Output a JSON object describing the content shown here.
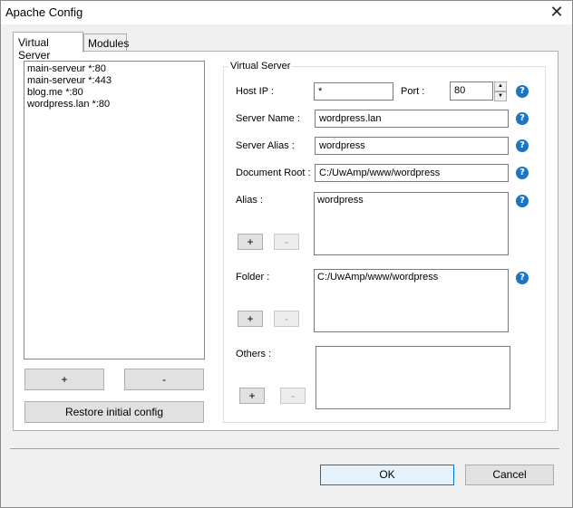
{
  "window": {
    "title": "Apache Config",
    "close_glyph": "✕"
  },
  "tabs": [
    {
      "label": "Virtual Server",
      "active": true
    },
    {
      "label": "Modules",
      "active": false
    }
  ],
  "server_list": {
    "items": [
      "main-serveur *:80",
      "main-serveur *:443",
      "blog.me *:80",
      "wordpress.lan *:80"
    ]
  },
  "left_buttons": {
    "add": "+",
    "remove": "-",
    "restore": "Restore initial config"
  },
  "virtual_server": {
    "legend": "Virtual Server",
    "host_ip": {
      "label": "Host IP :",
      "value": "*"
    },
    "port": {
      "label": "Port :",
      "value": "80"
    },
    "server_name": {
      "label": "Server Name :",
      "value": "wordpress.lan"
    },
    "server_alias": {
      "label": "Server Alias :",
      "value": "wordpress"
    },
    "document_root": {
      "label": "Document Root :",
      "value": "C:/UwAmp/www/wordpress"
    },
    "alias": {
      "label": "Alias :",
      "value": "wordpress",
      "add": "+",
      "remove": "-"
    },
    "folder": {
      "label": "Folder :",
      "value": "C:/UwAmp/www/wordpress",
      "add": "+",
      "remove": "-"
    },
    "others": {
      "label": "Others :",
      "value": "",
      "add": "+",
      "remove": "-"
    },
    "help_glyph": "?"
  },
  "footer": {
    "ok": "OK",
    "cancel": "Cancel"
  },
  "colors": {
    "help_icon": "#1b74c4",
    "ok_border": "#0078d7"
  }
}
